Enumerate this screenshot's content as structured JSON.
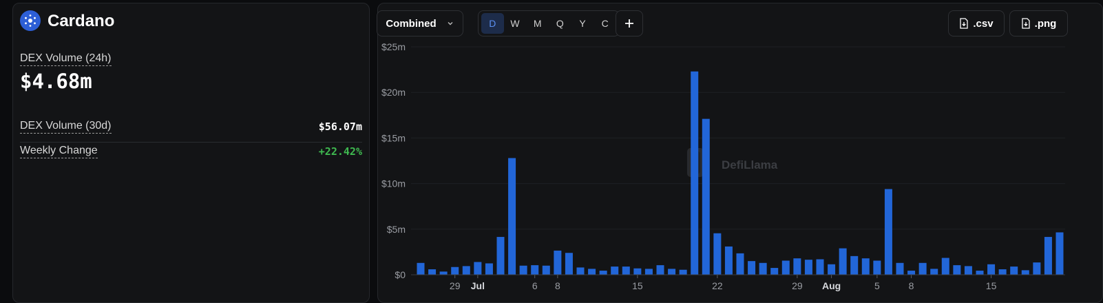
{
  "left": {
    "title": "Cardano",
    "dex_volume_24h_label": "DEX Volume (24h)",
    "dex_volume_24h_value": "$4.68m",
    "dex_volume_30d_label": "DEX Volume (30d)",
    "dex_volume_30d_value": "$56.07m",
    "weekly_change_label": "Weekly Change",
    "weekly_change_value": "+22.42%",
    "positive_color": "#3fb950"
  },
  "toolbar": {
    "dropdown_label": "Combined",
    "periods": [
      "D",
      "W",
      "M",
      "Q",
      "Y",
      "C"
    ],
    "active_period": "D",
    "add_icon": "plus-icon",
    "csv_label": ".csv",
    "png_label": ".png",
    "download_icon": "file-download-icon"
  },
  "watermark": "DefiLlama",
  "chart_data": {
    "type": "bar",
    "bar_color": "#2266d8",
    "y_ticks": [
      "$0",
      "$5m",
      "$10m",
      "$15m",
      "$20m",
      "$25m"
    ],
    "ylim": [
      0,
      25
    ],
    "y_unit": "millions USD",
    "x_tick_labels": [
      {
        "label": "29",
        "index": 3,
        "bold": false
      },
      {
        "label": "Jul",
        "index": 5,
        "bold": true
      },
      {
        "label": "6",
        "index": 10,
        "bold": false
      },
      {
        "label": "8",
        "index": 12,
        "bold": false
      },
      {
        "label": "15",
        "index": 19,
        "bold": false
      },
      {
        "label": "22",
        "index": 26,
        "bold": false
      },
      {
        "label": "29",
        "index": 33,
        "bold": false
      },
      {
        "label": "Aug",
        "index": 36,
        "bold": true
      },
      {
        "label": "5",
        "index": 40,
        "bold": false
      },
      {
        "label": "8",
        "index": 43,
        "bold": false
      },
      {
        "label": "15",
        "index": 50,
        "bold": false
      }
    ],
    "values": [
      1.3,
      0.6,
      0.35,
      0.85,
      0.95,
      1.4,
      1.25,
      4.15,
      12.8,
      1.0,
      1.05,
      1.0,
      2.65,
      2.4,
      0.8,
      0.65,
      0.45,
      0.9,
      0.9,
      0.7,
      0.65,
      1.05,
      0.65,
      0.55,
      22.3,
      17.1,
      4.55,
      3.1,
      2.35,
      1.5,
      1.3,
      0.75,
      1.55,
      1.8,
      1.65,
      1.7,
      1.15,
      2.9,
      2.05,
      1.8,
      1.55,
      9.4,
      1.3,
      0.45,
      1.3,
      0.65,
      1.85,
      1.05,
      0.95,
      0.45,
      1.15,
      0.6,
      0.9,
      0.5,
      1.35,
      4.15,
      4.65
    ]
  }
}
